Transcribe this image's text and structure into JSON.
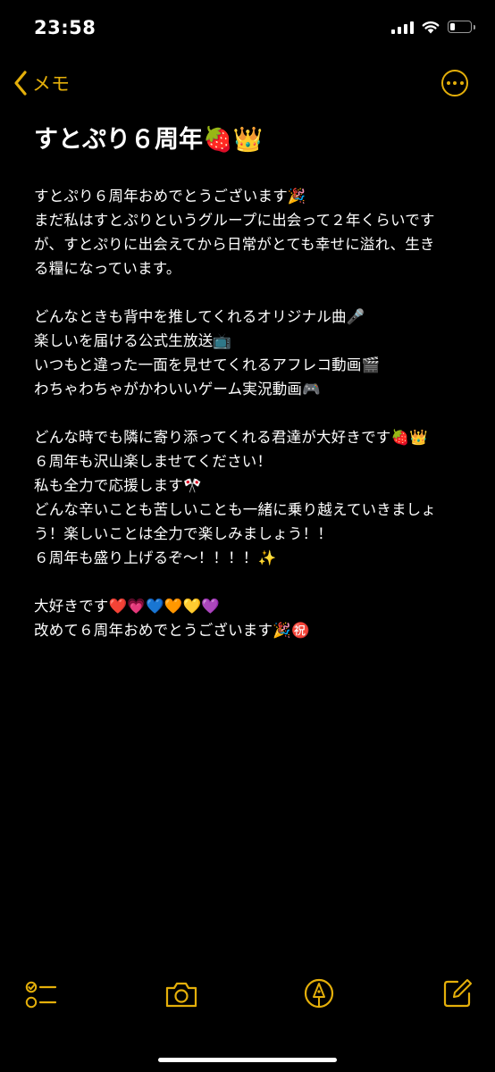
{
  "status_bar": {
    "time": "23:58",
    "battery_level": 0.25
  },
  "nav": {
    "back_label": "メモ",
    "back_icon": "chevron-left-icon",
    "more_icon": "ellipsis-circle-icon"
  },
  "note": {
    "title": "すとぷり６周年🍓👑",
    "lines": [
      "すとぷり６周年おめでとうございます🎉",
      "まだ私はすとぷりというグループに出会って２年くらいです",
      "が、すとぷりに出会えてから日常がとても幸せに溢れ、生き",
      "る糧になっています。",
      "",
      "どんなときも背中を推してくれるオリジナル曲🎤",
      "楽しいを届ける公式生放送📺",
      "いつもと違った一面を見せてくれるアフレコ動画🎬",
      "わちゃわちゃがかわいいゲーム実況動画🎮",
      "",
      "どんな時でも隣に寄り添ってくれる君達が大好きです🍓👑",
      "６周年も沢山楽しませてください！",
      "私も全力で応援します🎌",
      "どんな辛いことも苦しいことも一緒に乗り越えていきましょ",
      "う！楽しいことは全力で楽しみましょう！！",
      "６周年も盛り上げるぞ〜！！！！✨",
      "",
      "大好きです❤️💗💙🧡💛💜",
      "改めて６周年おめでとうございます🎉㊗️"
    ]
  },
  "toolbar": {
    "items": [
      "checklist-icon",
      "camera-icon",
      "markup-pen-icon",
      "compose-icon"
    ]
  },
  "colors": {
    "accent": "#e4af0a",
    "background": "#000000",
    "text": "#ffffff"
  }
}
